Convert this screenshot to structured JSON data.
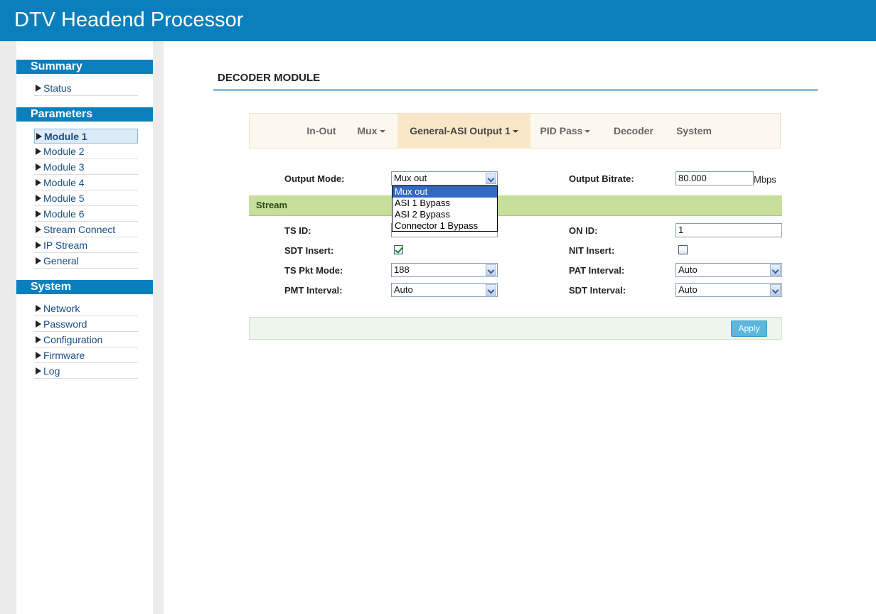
{
  "header": {
    "title": "DTV Headend Processor"
  },
  "sidebar": {
    "sections": [
      {
        "title": "Summary",
        "items": [
          {
            "label": "Status"
          }
        ]
      },
      {
        "title": "Parameters",
        "items": [
          {
            "label": "Module 1",
            "active": true
          },
          {
            "label": "Module 2"
          },
          {
            "label": "Module 3"
          },
          {
            "label": "Module 4"
          },
          {
            "label": "Module 5"
          },
          {
            "label": "Module 6"
          },
          {
            "label": "Stream Connect"
          },
          {
            "label": "IP Stream"
          },
          {
            "label": "General"
          }
        ]
      },
      {
        "title": "System",
        "items": [
          {
            "label": "Network"
          },
          {
            "label": "Password"
          },
          {
            "label": "Configuration"
          },
          {
            "label": "Firmware"
          },
          {
            "label": "Log"
          }
        ]
      }
    ]
  },
  "main": {
    "title": "DECODER MODULE",
    "tabs": [
      {
        "label": "In-Out"
      },
      {
        "label": "Mux",
        "dropdown": true
      },
      {
        "label": "General-ASI Output 1",
        "dropdown": true,
        "active": true
      },
      {
        "label": "PID Pass",
        "dropdown": true
      },
      {
        "label": "Decoder"
      },
      {
        "label": "System"
      }
    ],
    "output_mode": {
      "label": "Output Mode:",
      "value": "Mux out",
      "options": [
        "Mux out",
        "ASI 1 Bypass",
        "ASI 2 Bypass",
        "Connector 1 Bypass"
      ]
    },
    "output_bitrate": {
      "label": "Output Bitrate:",
      "value": "80.000",
      "unit": "Mbps"
    },
    "stream_section": {
      "title": "Stream"
    },
    "ts_id": {
      "label": "TS ID:",
      "value": ""
    },
    "on_id": {
      "label": "ON ID:",
      "value": "1"
    },
    "sdt_insert": {
      "label": "SDT Insert:",
      "checked": true
    },
    "nit_insert": {
      "label": "NIT Insert:",
      "checked": false
    },
    "ts_pkt_mode": {
      "label": "TS Pkt Mode:",
      "value": "188"
    },
    "pat_interval": {
      "label": "PAT Interval:",
      "value": "Auto"
    },
    "pmt_interval": {
      "label": "PMT Interval:",
      "value": "Auto"
    },
    "sdt_interval": {
      "label": "SDT Interval:",
      "value": "Auto"
    },
    "apply_label": "Apply"
  },
  "colors": {
    "header_bg": "#0a7fbd",
    "stream_bar": "#c6df9a",
    "active_tab": "#f9e7c8",
    "apply_button": "#5ab8e0",
    "dropdown_selected": "#316ac5"
  }
}
